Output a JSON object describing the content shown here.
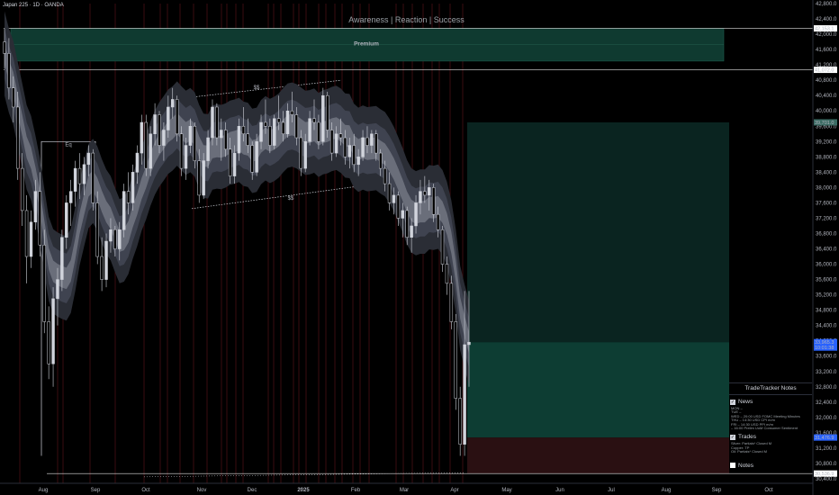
{
  "header": {
    "symbol": "Japan 225 · 1D · OANDA",
    "title": "Awareness | Reaction | Success"
  },
  "colors": {
    "background": "#000000",
    "premium_zone": "#0f3a30",
    "upper_target_zone": "#0a2420",
    "lower_target_zone": "#0d3d33",
    "stop_zone": "#2a1012",
    "candle": "#d1d4dc",
    "band_outer": "#2a2d35",
    "band_mid": "#3f4350",
    "band_inner": "#6a6e7a",
    "red_vline": "#3a0d10"
  },
  "annotations": {
    "premium_label": "Premium",
    "eq_label": "Eq",
    "ss_top_label": "$$",
    "ss_bottom_label": "$$"
  },
  "notes_panel": {
    "title": "TradeTracker Notes",
    "news_label": "News",
    "news_lines": [
      "MON –",
      "TUE –",
      "WED – 20:00 USD FOMC Meeting Minutes",
      "THU – 14:30 USD CPI m/m",
      "FRI – 14:30 USD PPI m/m",
      "   – 16:00 Prelim UoM Consumer Sentiment"
    ],
    "trades_label": "Trades",
    "trades_lines": [
      "Silver: Partials* Closed M",
      "Copper: TP",
      "Oil: Partials* Closed M"
    ],
    "notes_label": "Notes"
  },
  "chart_data": {
    "type": "candlestick",
    "instrument": "Japan 225",
    "timeframe": "1D",
    "broker": "OANDA",
    "y_ticks": [
      30400,
      30800,
      31200,
      31600,
      32000,
      32400,
      32800,
      33200,
      33600,
      34000,
      34400,
      34800,
      35200,
      35600,
      36000,
      36400,
      36800,
      37200,
      37600,
      38000,
      38400,
      38800,
      39200,
      39600,
      40000,
      40400,
      40800,
      41200,
      41600,
      42000,
      42400,
      42800
    ],
    "y_tick_labels": [
      "30,400.0",
      "30,800.0",
      "31,200.0",
      "31,600.0",
      "32,000.0",
      "32,400.0",
      "32,800.0",
      "33,200.0",
      "33,600.0",
      "34,000.0",
      "34,400.0",
      "34,800.0",
      "35,200.0",
      "35,600.0",
      "36,000.0",
      "36,400.0",
      "36,800.0",
      "37,200.0",
      "37,600.0",
      "38,000.0",
      "38,400.0",
      "38,800.0",
      "39,200.0",
      "39,600.0",
      "40,000.0",
      "40,400.0",
      "40,800.0",
      "41,200.0",
      "41,600.0",
      "42,000.0",
      "42,400.0",
      "42,800.0"
    ],
    "ylim": [
      30250,
      42900
    ],
    "x_labels": [
      "Aug",
      "Sep",
      "Oct",
      "Nov",
      "Dec",
      "2025",
      "Feb",
      "Mar",
      "Apr",
      "May",
      "Jun",
      "Jul",
      "Aug",
      "Sep",
      "Oct"
    ],
    "price_labels": [
      {
        "value": 42153.1,
        "text": "42,153.1",
        "style": "white"
      },
      {
        "value": 41072.0,
        "text": "41,072.0",
        "style": "white"
      },
      {
        "value": 39701.0,
        "text": "39,701.0",
        "style": "teal"
      },
      {
        "value": 33965.3,
        "text": "33,965.3",
        "style": "blue"
      },
      {
        "value": 33965.3,
        "text": "10:01:38",
        "style": "blue-sub"
      },
      {
        "value": 31476.9,
        "text": "31,476.9",
        "style": "blue"
      },
      {
        "value": 30536.9,
        "text": "30,536.9",
        "style": "white"
      }
    ],
    "levels": {
      "premium_top": 42153.1,
      "premium_bottom": 41300,
      "high_line": 42153.1,
      "upper_line": 41072.0,
      "eq": 39200,
      "low_line": 30536.9,
      "target_top": 39701.0,
      "entry": 33965.3,
      "stop_top": 31476.9
    },
    "candles": [
      [
        41800,
        42150,
        41100,
        41500
      ],
      [
        41500,
        41900,
        40300,
        40600
      ],
      [
        40600,
        40900,
        39700,
        40100
      ],
      [
        40100,
        40500,
        38200,
        38500
      ],
      [
        38500,
        38900,
        37000,
        37400
      ],
      [
        37400,
        37800,
        35500,
        36200
      ],
      [
        36200,
        37400,
        35900,
        37100
      ],
      [
        37100,
        38200,
        36900,
        37900
      ],
      [
        37900,
        38400,
        36200,
        36500
      ],
      [
        36500,
        36900,
        34200,
        34500
      ],
      [
        34500,
        34900,
        33000,
        33400
      ],
      [
        33400,
        35400,
        32800,
        35100
      ],
      [
        35100,
        35900,
        34400,
        35600
      ],
      [
        35600,
        36900,
        35300,
        36700
      ],
      [
        36700,
        37800,
        36400,
        37600
      ],
      [
        37600,
        38200,
        37000,
        37900
      ],
      [
        37900,
        38700,
        37500,
        38500
      ],
      [
        38500,
        38900,
        37700,
        38100
      ],
      [
        38100,
        38800,
        37800,
        38600
      ],
      [
        38600,
        39100,
        38300,
        38900
      ],
      [
        38900,
        39000,
        37400,
        37600
      ],
      [
        37600,
        37900,
        36000,
        36200
      ],
      [
        36200,
        36700,
        35300,
        35600
      ],
      [
        35600,
        36800,
        35400,
        36600
      ],
      [
        36600,
        37200,
        36300,
        36900
      ],
      [
        36900,
        37000,
        36200,
        36400
      ],
      [
        36400,
        37100,
        36100,
        36900
      ],
      [
        36900,
        38100,
        36700,
        37900
      ],
      [
        37900,
        38400,
        37300,
        37600
      ],
      [
        37600,
        38600,
        37400,
        38400
      ],
      [
        38400,
        39100,
        38100,
        38900
      ],
      [
        38900,
        39900,
        38600,
        39700
      ],
      [
        39700,
        39900,
        38300,
        38500
      ],
      [
        38500,
        39600,
        38300,
        39400
      ],
      [
        39400,
        40200,
        39100,
        39900
      ],
      [
        39900,
        40000,
        38900,
        39100
      ],
      [
        39100,
        39700,
        38700,
        39500
      ],
      [
        39500,
        40400,
        39300,
        40100
      ],
      [
        40100,
        40600,
        39800,
        40300
      ],
      [
        40300,
        40400,
        39200,
        39400
      ],
      [
        39400,
        39600,
        38300,
        38500
      ],
      [
        38500,
        39300,
        38200,
        39100
      ],
      [
        39100,
        39800,
        38900,
        39600
      ],
      [
        39600,
        39700,
        38500,
        38700
      ],
      [
        38700,
        39000,
        37600,
        37800
      ],
      [
        37800,
        38900,
        37700,
        38700
      ],
      [
        38700,
        39500,
        38500,
        39300
      ],
      [
        39300,
        40300,
        39100,
        40100
      ],
      [
        40100,
        40200,
        39100,
        39300
      ],
      [
        39300,
        39800,
        38700,
        39500
      ],
      [
        39500,
        39700,
        38800,
        39000
      ],
      [
        39000,
        39300,
        38100,
        38300
      ],
      [
        38300,
        39100,
        38100,
        38900
      ],
      [
        38900,
        39800,
        38700,
        39600
      ],
      [
        39600,
        40100,
        39200,
        39400
      ],
      [
        39400,
        39800,
        38900,
        39100
      ],
      [
        39100,
        39200,
        38200,
        38400
      ],
      [
        38400,
        39400,
        38300,
        39200
      ],
      [
        39200,
        39900,
        39000,
        39700
      ],
      [
        39700,
        40300,
        39400,
        39600
      ],
      [
        39600,
        39800,
        38900,
        39100
      ],
      [
        39100,
        39900,
        39000,
        39800
      ],
      [
        39800,
        40400,
        39500,
        39700
      ],
      [
        39700,
        40000,
        39200,
        39400
      ],
      [
        39400,
        40200,
        39300,
        40000
      ],
      [
        40000,
        40500,
        39700,
        39900
      ],
      [
        39900,
        40100,
        39100,
        39300
      ],
      [
        39300,
        39500,
        38300,
        38500
      ],
      [
        38500,
        39400,
        38400,
        39200
      ],
      [
        39200,
        40000,
        39100,
        39800
      ],
      [
        39800,
        40300,
        39500,
        39700
      ],
      [
        39700,
        39900,
        39000,
        39200
      ],
      [
        39200,
        40600,
        39100,
        40400
      ],
      [
        40400,
        40500,
        39300,
        39500
      ],
      [
        39500,
        39700,
        38700,
        38900
      ],
      [
        38900,
        39600,
        38800,
        39400
      ],
      [
        39400,
        39800,
        39100,
        39300
      ],
      [
        39300,
        39500,
        38600,
        38800
      ],
      [
        38800,
        39300,
        38500,
        39100
      ],
      [
        39100,
        39400,
        38400,
        38600
      ],
      [
        38600,
        39000,
        38300,
        38800
      ],
      [
        38800,
        39500,
        38700,
        39300
      ],
      [
        39300,
        39600,
        38900,
        39100
      ],
      [
        39100,
        39500,
        38900,
        39400
      ],
      [
        39400,
        39500,
        38700,
        38900
      ],
      [
        38900,
        39000,
        38300,
        38500
      ],
      [
        38500,
        38700,
        37900,
        38100
      ],
      [
        38100,
        38400,
        37400,
        37600
      ],
      [
        37600,
        38000,
        37300,
        37800
      ],
      [
        37800,
        37900,
        37000,
        37200
      ],
      [
        37200,
        37600,
        36700,
        37400
      ],
      [
        37400,
        37500,
        36500,
        36700
      ],
      [
        36700,
        37200,
        36300,
        37000
      ],
      [
        37000,
        37800,
        36800,
        37600
      ],
      [
        37600,
        38200,
        37300,
        37900
      ],
      [
        37900,
        38300,
        37600,
        37800
      ],
      [
        37800,
        38200,
        37400,
        38000
      ],
      [
        38000,
        38100,
        37100,
        37300
      ],
      [
        37300,
        37500,
        36700,
        36900
      ],
      [
        36900,
        37000,
        35800,
        36000
      ],
      [
        36000,
        36200,
        35200,
        35500
      ],
      [
        35500,
        35700,
        34300,
        34500
      ],
      [
        34500,
        34700,
        32200,
        32500
      ],
      [
        32500,
        32800,
        31000,
        31300
      ],
      [
        31300,
        35300,
        31000,
        33900
      ],
      [
        33900,
        35300,
        32800,
        33965
      ]
    ]
  }
}
